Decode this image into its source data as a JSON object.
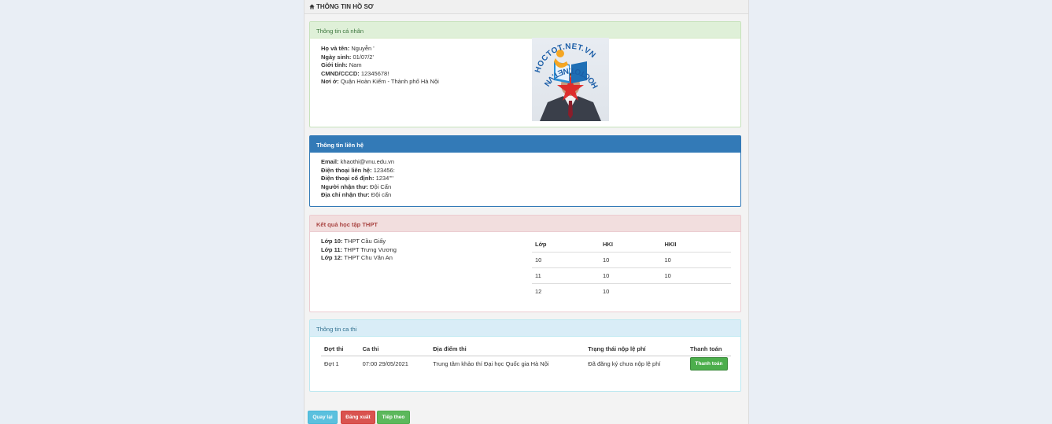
{
  "header": {
    "title": "THÔNG TIN HỒ SƠ"
  },
  "personal": {
    "heading": "Thông tin cá nhân",
    "fields": [
      {
        "label": "Họ và tên:",
        "value": "Nguyễn '"
      },
      {
        "label": "Ngày sinh:",
        "value": "01/07/2'"
      },
      {
        "label": "Giới tính:",
        "value": "Nam"
      },
      {
        "label": "CMND/CCCD:",
        "value": "12345678!"
      },
      {
        "label": "Nơi ở:",
        "value": "Quận Hoàn Kiếm - Thành phố Hà Nội"
      }
    ],
    "watermark_top": "HOCTOT.NET.VN",
    "watermark_bottom": "HOCTOT.NET.VN"
  },
  "contact": {
    "heading": "Thông tin liên hệ",
    "fields": [
      {
        "label": "Email:",
        "value": "khaothi@vnu.edu.vn"
      },
      {
        "label": "Điện thoại liên hệ:",
        "value": "123456:"
      },
      {
        "label": "Điện thoại cố định:",
        "value": "1234''''"
      },
      {
        "label": "Người nhận thư:",
        "value": "Đội Cấn"
      },
      {
        "label": "Địa chỉ nhận thư:",
        "value": "Đội cấn"
      }
    ]
  },
  "result": {
    "heading": "Kết quả học tập THPT",
    "classes": [
      {
        "label": "Lớp 10:",
        "value": "THPT Cầu Giấy"
      },
      {
        "label": "Lớp 11:",
        "value": "THPT Trưng Vương"
      },
      {
        "label": "Lớp 12:",
        "value": "THPT Chu Văn An"
      }
    ],
    "table_headers": [
      "Lớp",
      "HKI",
      "HKII"
    ],
    "rows": [
      [
        "10",
        "10",
        "10"
      ],
      [
        "11",
        "10",
        "10"
      ],
      [
        "12",
        "10",
        ""
      ]
    ]
  },
  "exam": {
    "heading": "Thông tin ca thi",
    "headers": [
      "Đợt thi",
      "Ca thi",
      "Địa điểm thi",
      "Trạng thái nộp lệ phí",
      "Thanh toán"
    ],
    "row": {
      "round": "Đợt 1",
      "session": "07:00 29/05/2021",
      "location": "Trung tâm khảo thí Đại học Quốc gia Hà Nội",
      "status": "Đã đăng ký chưa nộp lệ phí",
      "pay_label": "Thanh toán"
    }
  },
  "footer": {
    "back_label": "Quay lại",
    "logout_label": "Đăng xuất",
    "next_label": "Tiếp theo"
  },
  "colors": {
    "success_head": "#dff0d8",
    "primary_head": "#337ab7",
    "danger_head": "#f2dede",
    "info_head": "#d9edf7"
  }
}
